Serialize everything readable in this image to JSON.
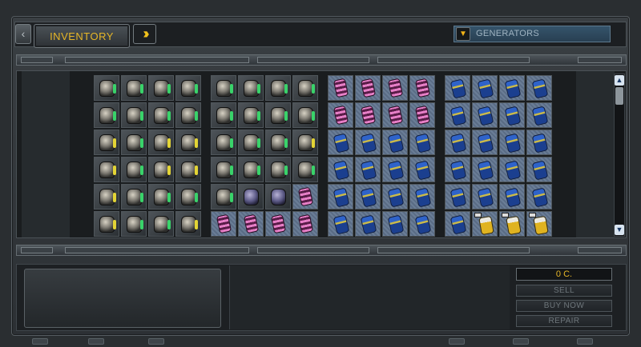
{
  "header": {
    "back_icon": "chevron-left-icon",
    "tab_label": "INVENTORY",
    "forward_icon": "double-chevron-right-icon",
    "filter": {
      "arrow_icon": "triangle-down-icon",
      "value": "GENERATORS"
    }
  },
  "inventory": {
    "groups": [
      {
        "rows": [
          [
            "dark-green",
            "dark-green",
            "dark-green",
            "dark-green"
          ],
          [
            "dark-green",
            "dark-green",
            "dark-green",
            "dark-green"
          ],
          [
            "dark-yellow",
            "dark-green",
            "dark-yellow",
            "dark-yellow"
          ],
          [
            "dark-yellow",
            "dark-green",
            "dark-yellow",
            "dark-yellow"
          ],
          [
            "dark-yellow",
            "dark-green",
            "dark-green",
            "dark-green"
          ],
          [
            "dark-yellow",
            "dark-green",
            "dark-green",
            "dark-yellow"
          ]
        ]
      },
      {
        "rows": [
          [
            "dark-green",
            "dark-green",
            "dark-green",
            "dark-green"
          ],
          [
            "dark-green",
            "dark-green",
            "dark-green",
            "dark-green"
          ],
          [
            "dark-green",
            "dark-green",
            "dark-green",
            "dark-yellow"
          ],
          [
            "dark-green",
            "dark-green",
            "dark-green",
            "dark-green"
          ],
          [
            "dark-green",
            "purple",
            "purple",
            "pink"
          ],
          [
            "pink",
            "pink",
            "pink",
            "pink"
          ]
        ]
      },
      {
        "rows": [
          [
            "pink",
            "pink",
            "pink",
            "pink"
          ],
          [
            "pink",
            "pink",
            "pink",
            "pink"
          ],
          [
            "blue",
            "blue",
            "blue",
            "blue"
          ],
          [
            "blue",
            "blue",
            "blue",
            "blue"
          ],
          [
            "blue",
            "blue",
            "blue",
            "blue"
          ],
          [
            "blue",
            "blue",
            "blue",
            "blue"
          ]
        ]
      },
      {
        "rows": [
          [
            "blue",
            "blue",
            "blue",
            "blue"
          ],
          [
            "blue",
            "blue",
            "blue",
            "blue"
          ],
          [
            "blue",
            "blue",
            "blue",
            "blue"
          ],
          [
            "blue",
            "blue",
            "blue",
            "blue"
          ],
          [
            "blue",
            "blue",
            "blue",
            "blue"
          ],
          [
            "blue",
            "gold",
            "gold",
            "gold"
          ]
        ]
      }
    ]
  },
  "scroll": {
    "up_icon": "scroll-up-arrow-icon",
    "down_icon": "scroll-down-arrow-icon"
  },
  "shop": {
    "price": "0 C.",
    "sell_label": "SELL",
    "buy_label": "BUY NOW",
    "repair_label": "REPAIR"
  },
  "colors": {
    "accent": "#e6b628",
    "panel": "#2c3034"
  }
}
